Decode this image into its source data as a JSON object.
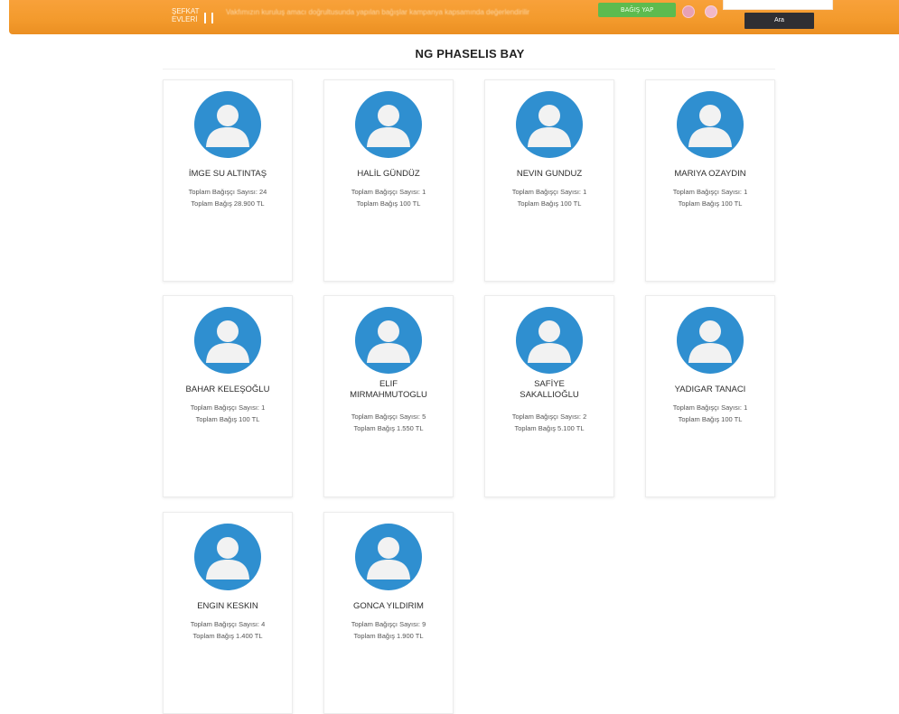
{
  "header": {
    "logo_text": "ŞEFKAT EVLERİ",
    "ticker_text": "Vakfımızın kuruluş amacı doğrultusunda yapılan bağışlar kampanya kapsamında değerlendirilir",
    "bagis_button": "BAĞIŞ YAP",
    "search_placeholder": "",
    "search_button": "Ara"
  },
  "page": {
    "title": "NG PHASELIS BAY"
  },
  "cards": [
    {
      "name": "İMGE SU ALTINTAŞ",
      "count": "Toplam Bağışçı Sayısı: 24",
      "total": "Toplam Bağış 28.900 TL"
    },
    {
      "name": "HALİL GÜNDÜZ",
      "count": "Toplam Bağışçı Sayısı: 1",
      "total": "Toplam Bağış 100 TL"
    },
    {
      "name": "NEVIN GUNDUZ",
      "count": "Toplam Bağışçı Sayısı: 1",
      "total": "Toplam Bağış 100 TL"
    },
    {
      "name": "MARIYA OZAYDIN",
      "count": "Toplam Bağışçı Sayısı: 1",
      "total": "Toplam Bağış 100 TL"
    },
    {
      "name": "BAHAR KELEŞOĞLU",
      "count": "Toplam Bağışçı Sayısı: 1",
      "total": "Toplam Bağış 100 TL"
    },
    {
      "name": "ELIF MIRMAHMUTOGLU",
      "count": "Toplam Bağışçı Sayısı: 5",
      "total": "Toplam Bağış 1.550 TL"
    },
    {
      "name": "SAFİYE SAKALLIOĞLU",
      "count": "Toplam Bağışçı Sayısı: 2",
      "total": "Toplam Bağış 5.100 TL"
    },
    {
      "name": "YADIGAR TANACI",
      "count": "Toplam Bağışçı Sayısı: 1",
      "total": "Toplam Bağış 100 TL"
    },
    {
      "name": "ENGIN KESKIN",
      "count": "Toplam Bağışçı Sayısı: 4",
      "total": "Toplam Bağış 1.400 TL"
    },
    {
      "name": "GONCA YILDIRIM",
      "count": "Toplam Bağışçı Sayısı: 9",
      "total": "Toplam Bağış 1.900 TL"
    }
  ],
  "colors": {
    "header_orange": "#f39a2c",
    "avatar_blue": "#2f8fd0",
    "bagis_green": "#5dbb4f",
    "search_button_bg": "#2f2f33"
  },
  "icons": {
    "avatar": "user-silhouette-icon",
    "lang_tr": "flag-tr-icon",
    "lang_en": "flag-en-icon"
  }
}
